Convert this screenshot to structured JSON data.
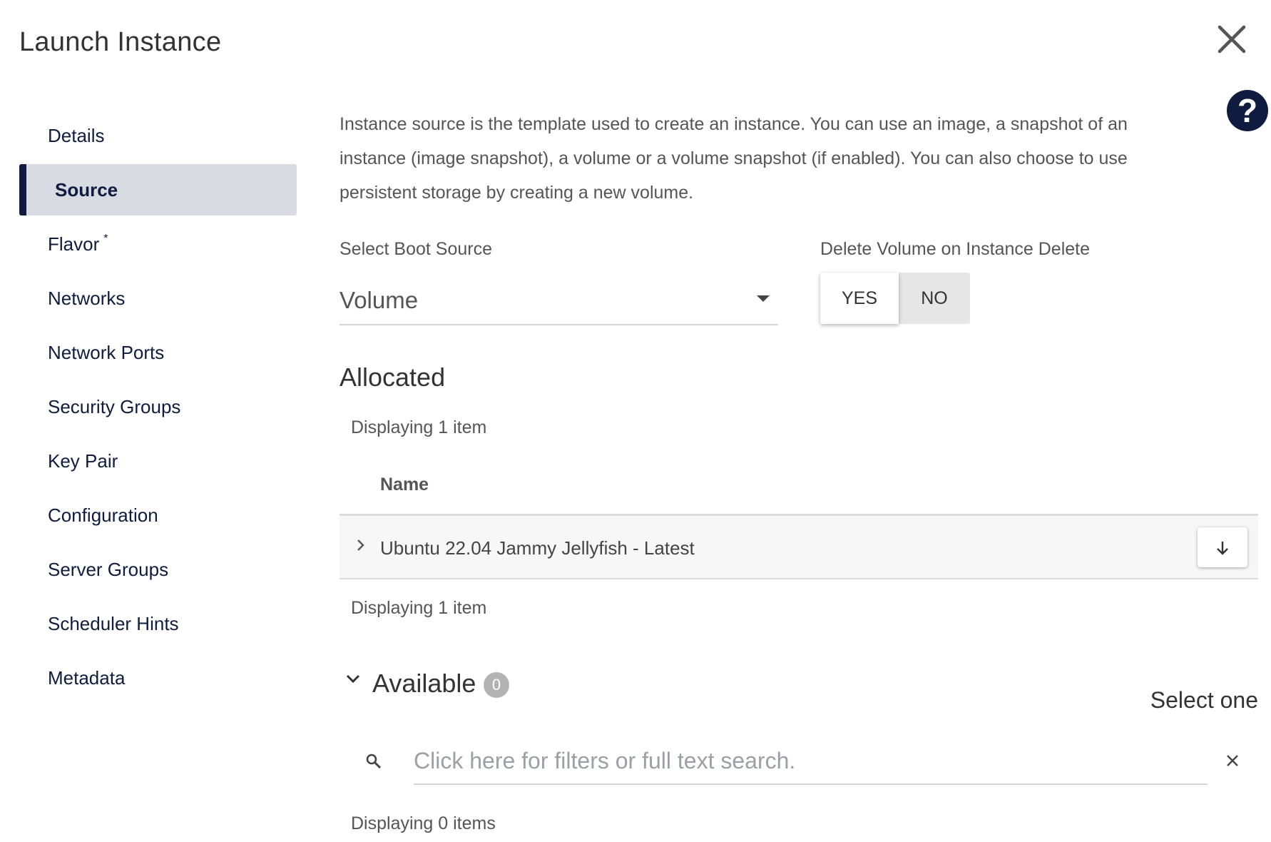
{
  "header": {
    "title": "Launch Instance"
  },
  "sidebar": {
    "items": [
      {
        "label": "Details"
      },
      {
        "label": "Source",
        "active": true
      },
      {
        "label": "Flavor",
        "required_marker": "*"
      },
      {
        "label": "Networks"
      },
      {
        "label": "Network Ports"
      },
      {
        "label": "Security Groups"
      },
      {
        "label": "Key Pair"
      },
      {
        "label": "Configuration"
      },
      {
        "label": "Server Groups"
      },
      {
        "label": "Scheduler Hints"
      },
      {
        "label": "Metadata"
      }
    ]
  },
  "main": {
    "description": "Instance source is the template used to create an instance. You can use an image, a snapshot of an instance (image snapshot), a volume or a volume snapshot (if enabled). You can also choose to use persistent storage by creating a new volume.",
    "boot_source": {
      "label": "Select Boot Source",
      "value": "Volume"
    },
    "delete_volume": {
      "label": "Delete Volume on Instance Delete",
      "yes": "YES",
      "no": "NO",
      "selected": "YES"
    },
    "allocated": {
      "heading": "Allocated",
      "count_top": "Displaying 1 item",
      "column_name": "Name",
      "rows": [
        {
          "name": "Ubuntu 22.04 Jammy Jellyfish - Latest"
        }
      ],
      "count_bottom": "Displaying 1 item"
    },
    "available": {
      "heading": "Available",
      "badge": "0",
      "select_hint": "Select one",
      "search_placeholder": "Click here for filters or full text search.",
      "count": "Displaying 0 items"
    }
  },
  "colors": {
    "brand_navy": "#0f1c3f",
    "active_bg": "#d8dbe1",
    "badge_gray": "#b3b3b3"
  },
  "icons": {
    "close": "close-icon",
    "help": "help-icon",
    "expand_row": "chevron-right-icon",
    "deallocate": "arrow-down-icon",
    "collapse_available": "chevron-down-icon",
    "search": "search-icon",
    "clear": "clear-icon"
  }
}
